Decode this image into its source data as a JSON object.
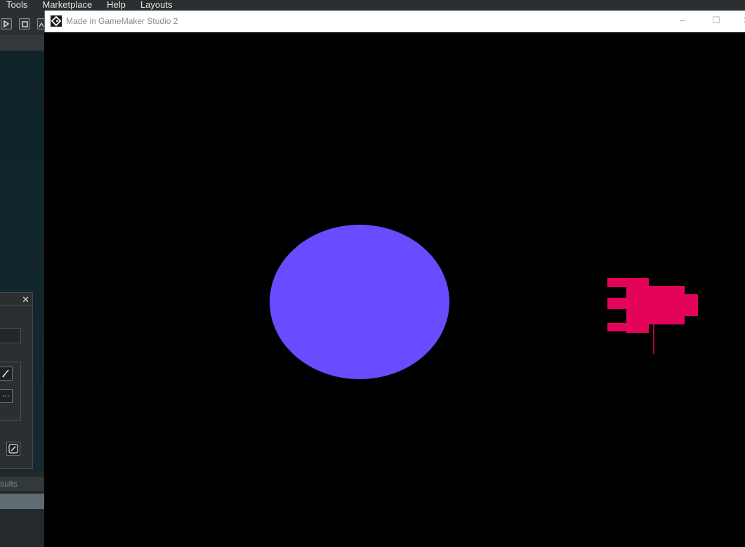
{
  "ide": {
    "menu": [
      "Tools",
      "Marketplace",
      "Help",
      "Layouts"
    ],
    "toolbar": {
      "icons": [
        "play-icon",
        "stop-icon",
        "clean-icon"
      ]
    },
    "panel": {
      "close_label": "✕",
      "more_label": "···"
    },
    "output_tab_label": "sults"
  },
  "game_window": {
    "title": "Made in GameMaker Studio 2",
    "controls": {
      "minimize": "–",
      "maximize": "☐",
      "close": "✕"
    }
  },
  "scene": {
    "background_color": "#000000",
    "planet_color": "#6a4bff",
    "ship_color": "#e3045a"
  }
}
